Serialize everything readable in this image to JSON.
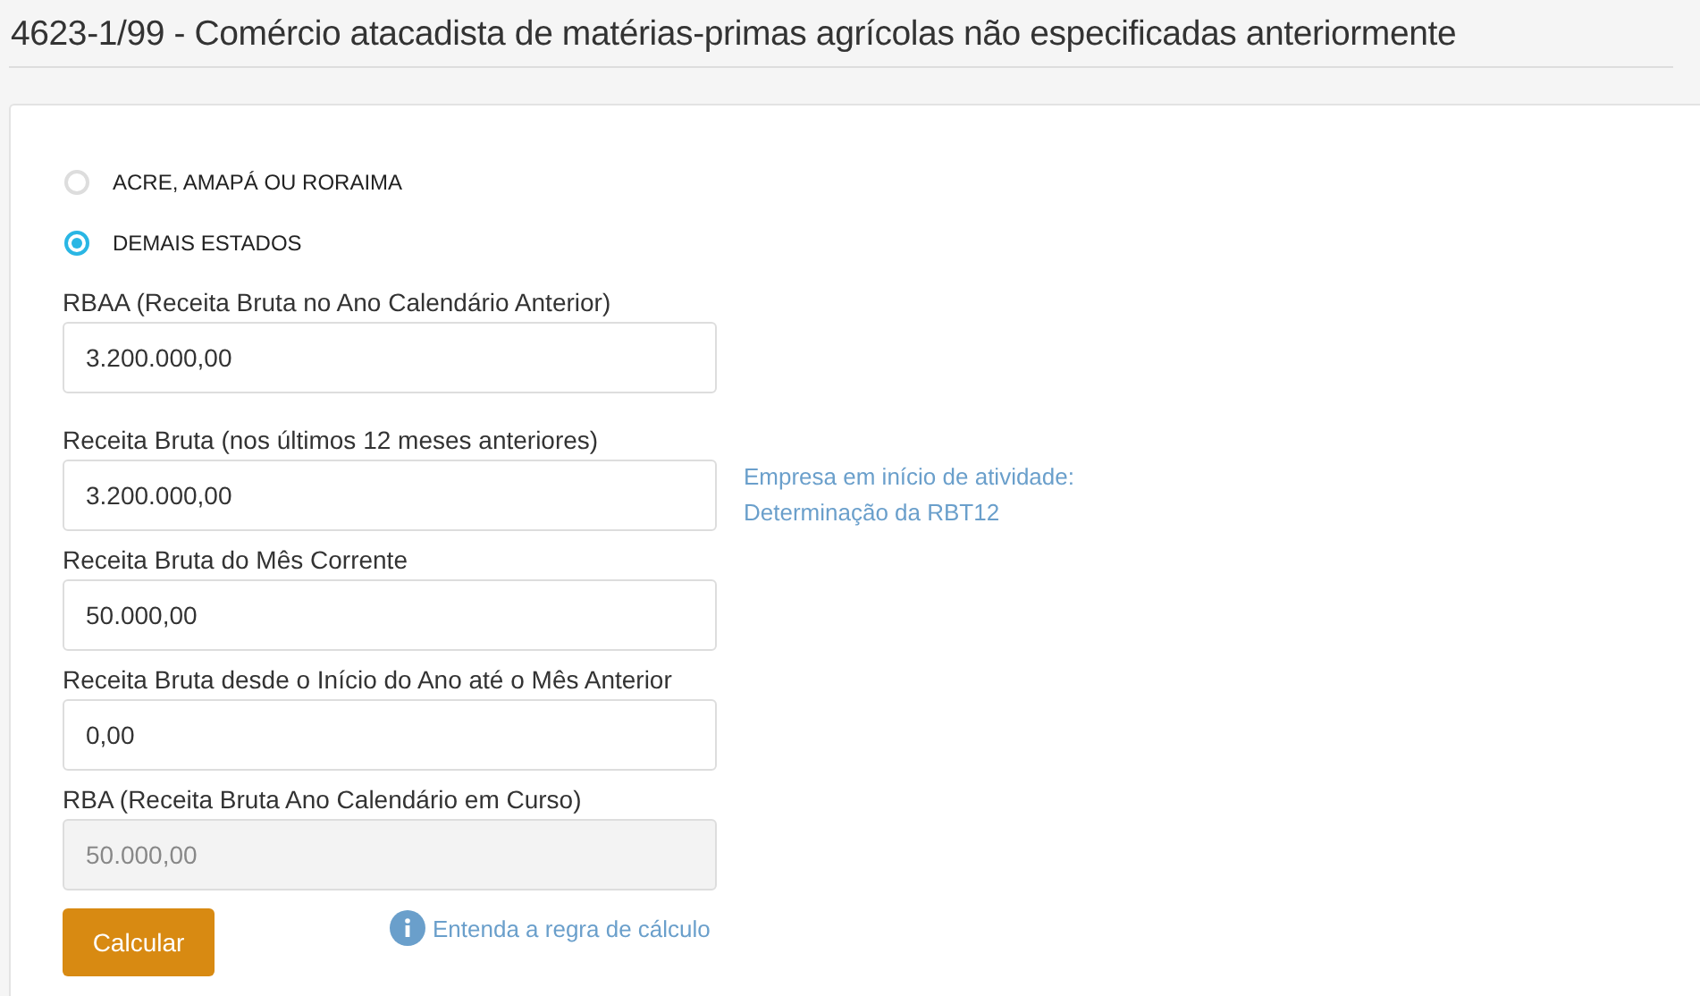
{
  "title": "4623-1/99 - Comércio atacadista de matérias-primas agrícolas não especificadas anteriormente",
  "regions": [
    {
      "label": "ACRE, AMAPÁ OU RORAIMA",
      "selected": false
    },
    {
      "label": "DEMAIS ESTADOS",
      "selected": true
    }
  ],
  "fields": [
    {
      "label": "RBAA (Receita Bruta no Ano Calendário Anterior)",
      "value": "3.200.000,00",
      "disabled": false
    },
    {
      "label": "Receita Bruta (nos últimos 12 meses anteriores)",
      "value": "3.200.000,00",
      "disabled": false,
      "link_lines": [
        "Empresa em início de atividade:",
        "Determinação da RBT12"
      ]
    },
    {
      "label": "Receita Bruta do Mês Corrente",
      "value": "50.000,00",
      "disabled": false
    },
    {
      "label": "Receita Bruta desde o Início do Ano até o Mês Anterior",
      "value": "0,00",
      "disabled": false
    },
    {
      "label": "RBA (Receita Bruta Ano Calendário em Curso)",
      "value": "50.000,00",
      "disabled": true
    }
  ],
  "button": "Calcular",
  "help_link": "Entenda a regra de cálculo"
}
